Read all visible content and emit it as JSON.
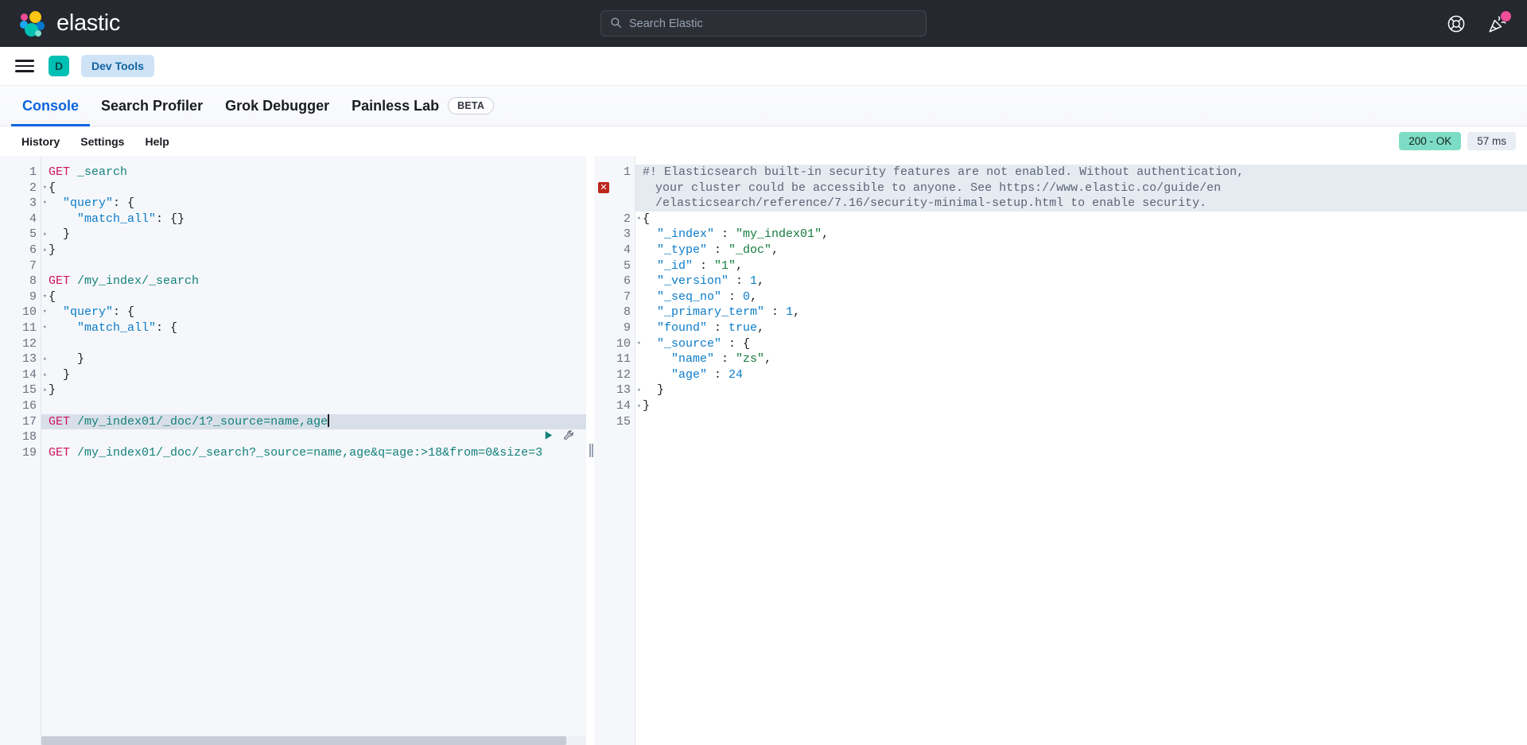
{
  "header": {
    "brand": "elastic",
    "search": {
      "placeholder": "Search Elastic",
      "icon": "search-icon"
    },
    "help_icon": "help-lifebuoy-icon",
    "whatsnew_icon": "party-popper-icon"
  },
  "breadcrumb": {
    "menu_icon": "hamburger-menu-icon",
    "space_initial": "D",
    "app_name": "Dev Tools"
  },
  "tabs": [
    {
      "label": "Console",
      "active": true,
      "badge": null
    },
    {
      "label": "Search Profiler",
      "active": false,
      "badge": null
    },
    {
      "label": "Grok Debugger",
      "active": false,
      "badge": null
    },
    {
      "label": "Painless Lab",
      "active": false,
      "badge": "BETA"
    }
  ],
  "console_toolbar": {
    "links": [
      "History",
      "Settings",
      "Help"
    ],
    "status_code": "200 - OK",
    "latency": "57 ms",
    "status_color": "#7ddcc5"
  },
  "request_editor": {
    "active_line": 17,
    "actions": {
      "play_icon": "play-triangle-icon",
      "wrench_icon": "wrench-icon"
    },
    "lines": [
      {
        "n": 1,
        "fold": "",
        "text": "GET _search"
      },
      {
        "n": 2,
        "fold": "▾",
        "text": "{"
      },
      {
        "n": 3,
        "fold": "▾",
        "text": "  \"query\": {"
      },
      {
        "n": 4,
        "fold": "",
        "text": "    \"match_all\": {}"
      },
      {
        "n": 5,
        "fold": "▴",
        "text": "  }"
      },
      {
        "n": 6,
        "fold": "▴",
        "text": "}"
      },
      {
        "n": 7,
        "fold": "",
        "text": ""
      },
      {
        "n": 8,
        "fold": "",
        "text": "GET /my_index/_search"
      },
      {
        "n": 9,
        "fold": "▾",
        "text": "{"
      },
      {
        "n": 10,
        "fold": "▾",
        "text": "  \"query\": {"
      },
      {
        "n": 11,
        "fold": "▾",
        "text": "    \"match_all\": {"
      },
      {
        "n": 12,
        "fold": "",
        "text": "      "
      },
      {
        "n": 13,
        "fold": "▴",
        "text": "    }"
      },
      {
        "n": 14,
        "fold": "▴",
        "text": "  }"
      },
      {
        "n": 15,
        "fold": "▴",
        "text": "}"
      },
      {
        "n": 16,
        "fold": "",
        "text": ""
      },
      {
        "n": 17,
        "fold": "",
        "text": "GET /my_index01/_doc/1?_source=name,age"
      },
      {
        "n": 18,
        "fold": "",
        "text": ""
      },
      {
        "n": 19,
        "fold": "",
        "text": "GET /my_index01/_doc/_search?_source=name,age&q=age:>18&from=0&size=3"
      }
    ]
  },
  "response_editor": {
    "error_marker": "error-x-icon",
    "warning": [
      "#! Elasticsearch built-in security features are not enabled. Without authentication,",
      "your cluster could be accessible to anyone. See https://www.elastic.co/guide/en",
      "/elasticsearch/reference/7.16/security-minimal-setup.html to enable security."
    ],
    "lines": [
      {
        "n": 1,
        "fold": "",
        "text": ""
      },
      {
        "n": 2,
        "fold": "▾",
        "text": "{"
      },
      {
        "n": 3,
        "fold": "",
        "text": "  \"_index\" : \"my_index01\","
      },
      {
        "n": 4,
        "fold": "",
        "text": "  \"_type\" : \"_doc\","
      },
      {
        "n": 5,
        "fold": "",
        "text": "  \"_id\" : \"1\","
      },
      {
        "n": 6,
        "fold": "",
        "text": "  \"_version\" : 1,"
      },
      {
        "n": 7,
        "fold": "",
        "text": "  \"_seq_no\" : 0,"
      },
      {
        "n": 8,
        "fold": "",
        "text": "  \"_primary_term\" : 1,"
      },
      {
        "n": 9,
        "fold": "",
        "text": "  \"found\" : true,"
      },
      {
        "n": 10,
        "fold": "▾",
        "text": "  \"_source\" : {"
      },
      {
        "n": 11,
        "fold": "",
        "text": "    \"name\" : \"zs\","
      },
      {
        "n": 12,
        "fold": "",
        "text": "    \"age\" : 24"
      },
      {
        "n": 13,
        "fold": "▴",
        "text": "  }"
      },
      {
        "n": 14,
        "fold": "▴",
        "text": "}"
      },
      {
        "n": 15,
        "fold": "",
        "text": ""
      }
    ],
    "response_values": {
      "_index": "my_index01",
      "_type": "_doc",
      "_id": "1",
      "_version": 1,
      "_seq_no": 0,
      "_primary_term": 1,
      "found": true,
      "_source": {
        "name": "zs",
        "age": 24
      }
    }
  }
}
